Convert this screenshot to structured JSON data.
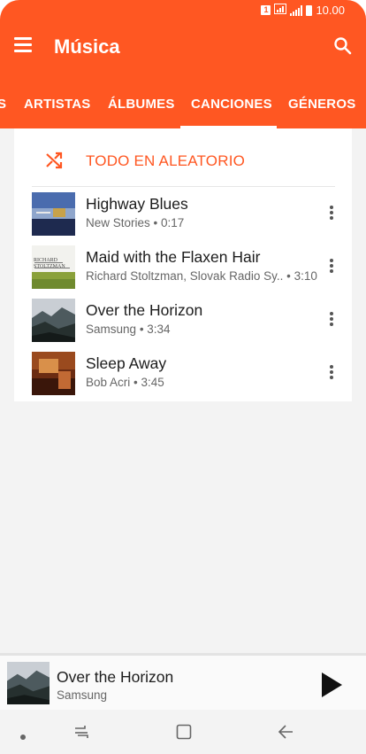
{
  "status_bar": {
    "sim_label": "1",
    "time": "10.00"
  },
  "toolbar": {
    "title": "Música",
    "menu_icon": "hamburger-menu-icon",
    "search_icon": "search-icon"
  },
  "tabs": [
    {
      "label": "S",
      "selected": false
    },
    {
      "label": "ARTISTAS",
      "selected": false
    },
    {
      "label": "ÁLBUMES",
      "selected": false
    },
    {
      "label": "CANCIONES",
      "selected": true
    },
    {
      "label": "GÉNEROS",
      "selected": false
    }
  ],
  "shuffle": {
    "label": "TODO EN ALEATORIO",
    "icon": "shuffle-icon"
  },
  "songs": [
    {
      "title": "Highway Blues",
      "artist": "New Stories",
      "duration": "• 0:17"
    },
    {
      "title": "Maid with the Flaxen Hair",
      "artist": "Richard Stoltzman, Slovak Radio Sy..",
      "duration": "• 3:10",
      "art_text": "RICHARD STOLTZMAN"
    },
    {
      "title": "Over the Horizon",
      "artist": "Samsung",
      "duration": "• 3:34"
    },
    {
      "title": "Sleep Away",
      "artist": "Bob Acri",
      "duration": "• 3:45"
    }
  ],
  "now_playing": {
    "title": "Over the Horizon",
    "artist": "Samsung",
    "play_icon": "play-icon"
  },
  "nav_bar": {
    "icons": [
      "dot-icon",
      "recent-apps-icon",
      "home-icon",
      "back-icon"
    ]
  },
  "colors": {
    "accent": "#ff5722",
    "background": "#f3f3f3"
  }
}
